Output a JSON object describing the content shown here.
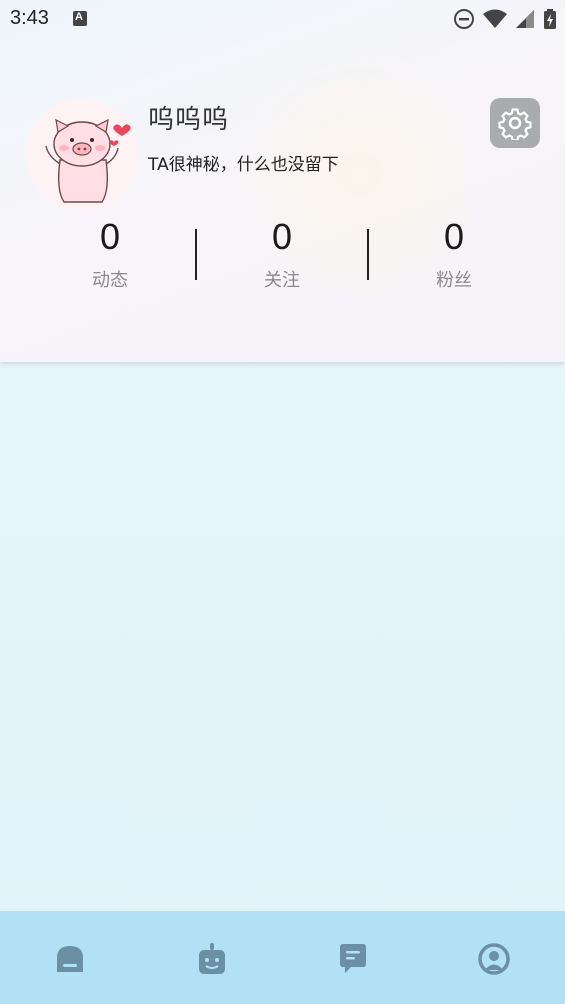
{
  "status_bar": {
    "time": "3:43",
    "notification_icon": "A",
    "icons": [
      "do-not-disturb-icon",
      "wifi-icon",
      "signal-icon",
      "battery-charging-icon"
    ]
  },
  "profile": {
    "username": "呜呜呜",
    "bio": "TA很神秘，什么也没留下",
    "avatar_icon": "pig-avatar",
    "settings_icon": "gear-icon"
  },
  "stats": [
    {
      "value": "0",
      "label": "动态"
    },
    {
      "value": "0",
      "label": "关注"
    },
    {
      "value": "0",
      "label": "粉丝"
    }
  ],
  "bottom_nav": [
    {
      "icon": "home-icon"
    },
    {
      "icon": "robot-icon"
    },
    {
      "icon": "message-icon"
    },
    {
      "icon": "profile-icon"
    }
  ],
  "colors": {
    "nav_background": "#b2e0f4",
    "nav_icon": "#6b8fa3",
    "settings_button": "#a9abad"
  }
}
